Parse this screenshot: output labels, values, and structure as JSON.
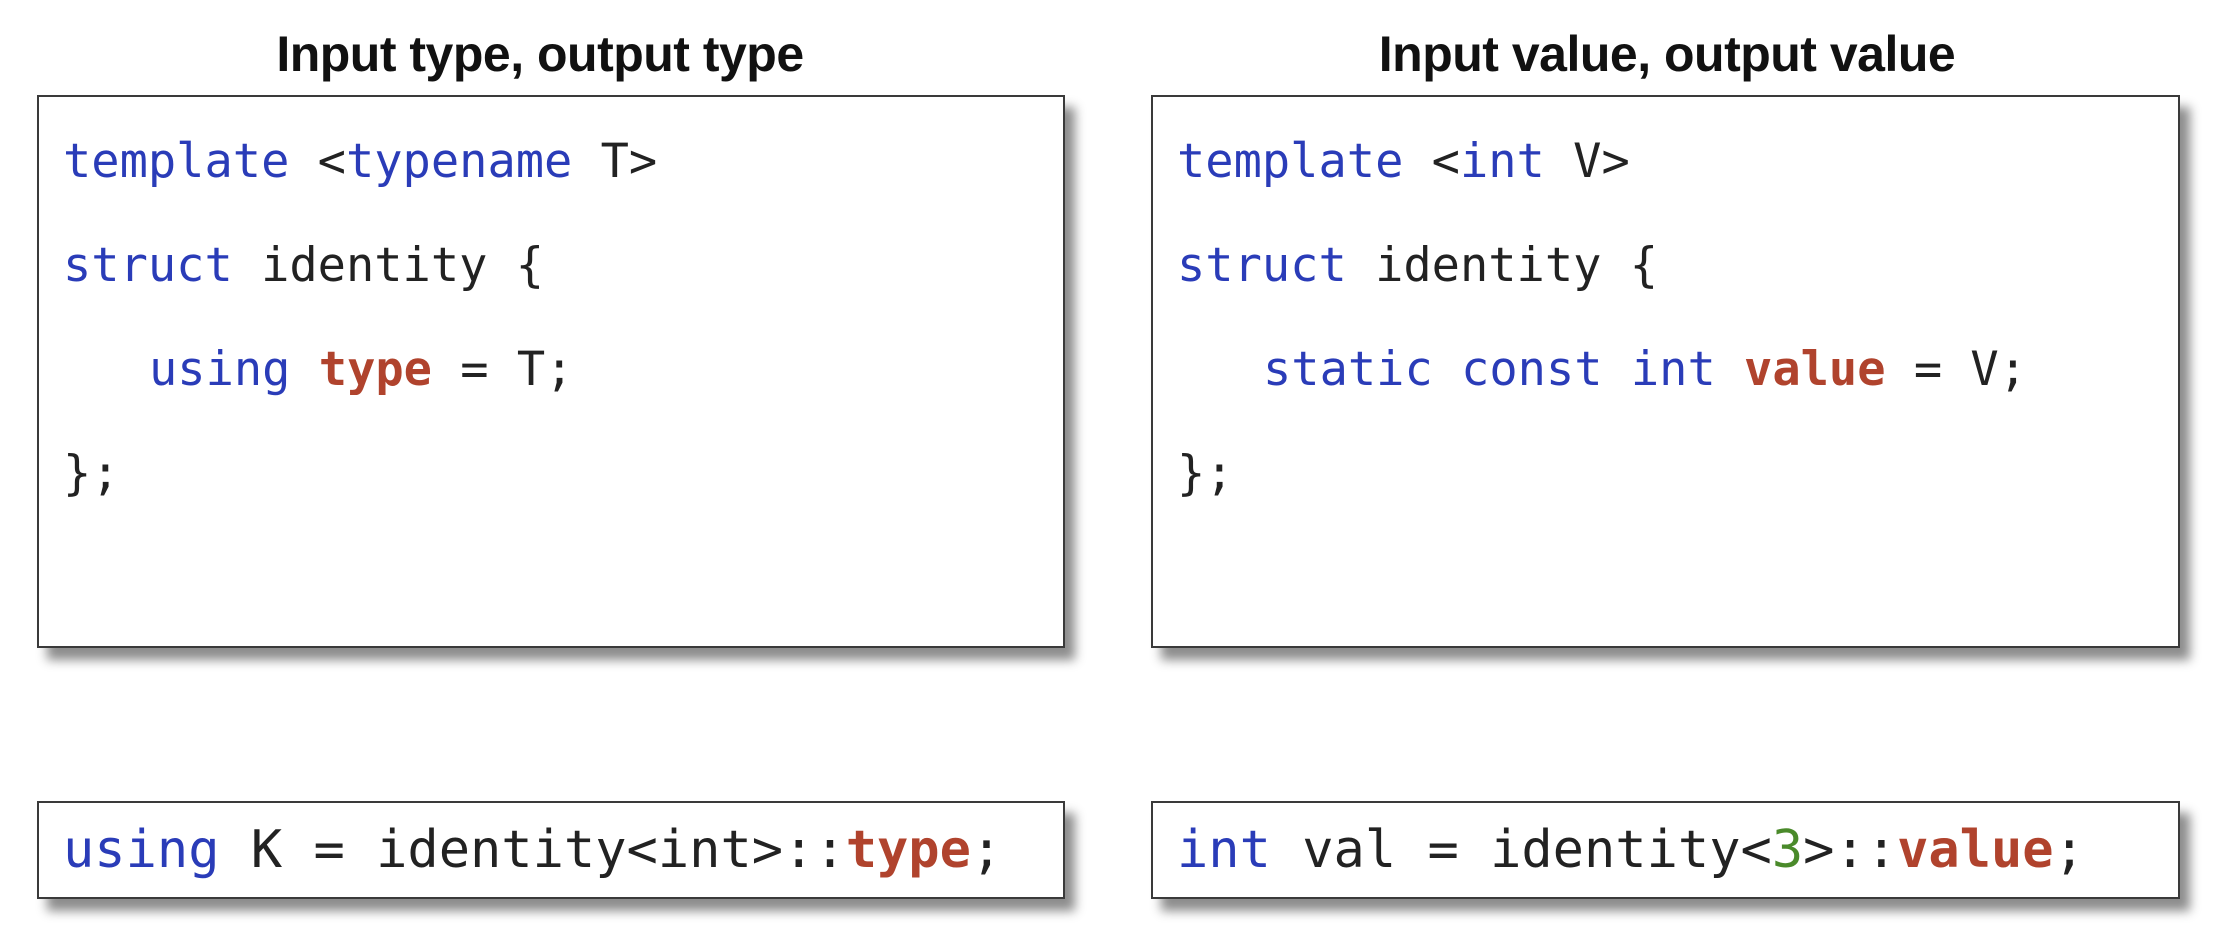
{
  "left": {
    "title": "Input type, output type",
    "code": {
      "line1": {
        "kw": "template",
        "rest_a": " <",
        "kw2": "typename",
        "rest_b": " T>"
      },
      "line2": {
        "kw": "struct",
        "rest": " identity {"
      },
      "line3": {
        "kw": "using",
        "sp": " ",
        "hl": "type",
        "rest": " = T;"
      },
      "line4": {
        "rest": "};"
      }
    },
    "usage": {
      "kw": "using",
      "rest": " K = identity<int>::",
      "hl": "type",
      "end": ";"
    }
  },
  "right": {
    "title": "Input value, output value",
    "code": {
      "line1": {
        "kw": "template",
        "rest_a": " <",
        "kw2": "int",
        "rest_b": " V>"
      },
      "line2": {
        "kw": "struct",
        "rest": " identity {"
      },
      "line3": {
        "kw": "static const int",
        "sp": " ",
        "hl": "value",
        "rest": " = V;"
      },
      "line4": {
        "rest": "};"
      }
    },
    "usage": {
      "kw": "int",
      "rest_a": " val = identity<",
      "num": "3",
      "rest_b": ">::",
      "hl": "value",
      "end": ";"
    }
  },
  "colors": {
    "keyword": "#2a3cb8",
    "highlight": "#b0432d",
    "number": "#4a8a2a",
    "text": "#222222"
  }
}
